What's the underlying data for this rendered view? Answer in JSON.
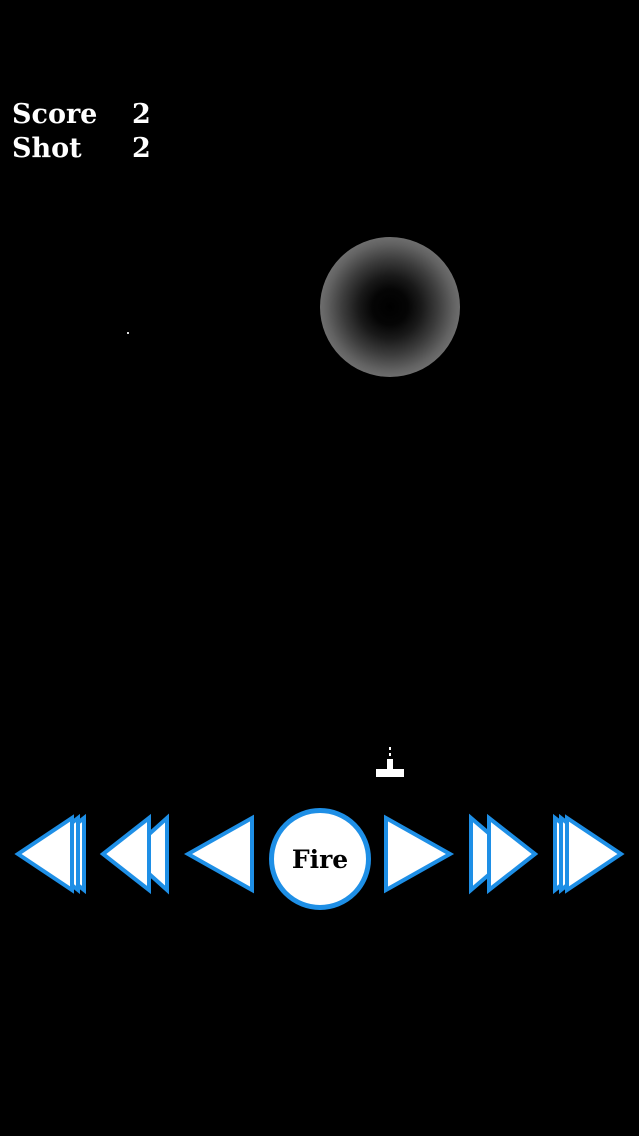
{
  "hud": {
    "score_label": "Score",
    "score_value": "2",
    "shot_label": "Shot",
    "shot_value": "2"
  },
  "controls": {
    "fire_label": "Fire",
    "buttons": [
      {
        "name": "left-fastest-icon",
        "direction": "left",
        "arrows": 3
      },
      {
        "name": "left-fast-icon",
        "direction": "left",
        "arrows": 2
      },
      {
        "name": "left-icon",
        "direction": "left",
        "arrows": 1
      },
      {
        "name": "right-icon",
        "direction": "right",
        "arrows": 1
      },
      {
        "name": "right-fast-icon",
        "direction": "right",
        "arrows": 2
      },
      {
        "name": "right-fastest-icon",
        "direction": "right",
        "arrows": 3
      }
    ]
  },
  "colors": {
    "background": "#000000",
    "button_fill": "#ffffff",
    "button_stroke": "#1e8fe6",
    "hud_text": "#ffffff"
  }
}
